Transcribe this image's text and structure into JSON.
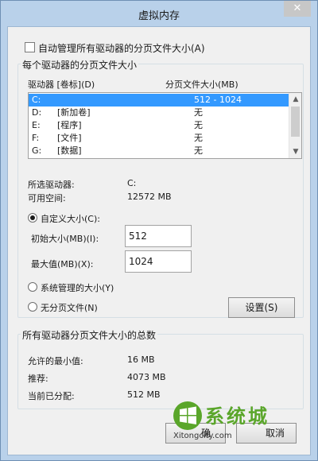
{
  "window": {
    "title": "虚拟内存",
    "close_glyph": "✕"
  },
  "auto_manage": {
    "label": "自动管理所有驱动器的分页文件大小(A)",
    "checked": false
  },
  "drive_group": {
    "title": "每个驱动器的分页文件大小",
    "col_drive": "驱动器 [卷标](D)",
    "col_size": "分页文件大小(MB)",
    "drives": [
      {
        "letter": "C:",
        "label": "",
        "size": "512 - 1024",
        "selected": true
      },
      {
        "letter": "D:",
        "label": "[新加卷]",
        "size": "无"
      },
      {
        "letter": "E:",
        "label": "[程序]",
        "size": "无"
      },
      {
        "letter": "F:",
        "label": "[文件]",
        "size": "无"
      },
      {
        "letter": "G:",
        "label": "[数据]",
        "size": "无"
      }
    ],
    "selected_drive_label": "所选驱动器:",
    "selected_drive_value": "C:",
    "free_space_label": "可用空间:",
    "free_space_value": "12572 MB",
    "custom_size_label": "自定义大小(C):",
    "initial_size_label": "初始大小(MB)(I):",
    "initial_size_value": "512",
    "max_size_label": "最大值(MB)(X):",
    "max_size_value": "1024",
    "system_managed_label": "系统管理的大小(Y)",
    "no_paging_label": "无分页文件(N)",
    "set_button": "设置(S)",
    "selected_mode": "custom"
  },
  "totals_group": {
    "title": "所有驱动器分页文件大小的总数",
    "min_allowed_label": "允许的最小值:",
    "min_allowed_value": "16 MB",
    "recommended_label": "推荐:",
    "recommended_value": "4073 MB",
    "current_label": "当前已分配:",
    "current_value": "512 MB"
  },
  "buttons": {
    "ok_partial": "确",
    "cancel_partial": "取消"
  },
  "watermark": {
    "text": "系统城",
    "url_text": "Xitongcity.com"
  },
  "colors": {
    "selection": "#3399ff",
    "title_bar": "#b9d1ea",
    "watermark_green": "#5aa62a"
  }
}
